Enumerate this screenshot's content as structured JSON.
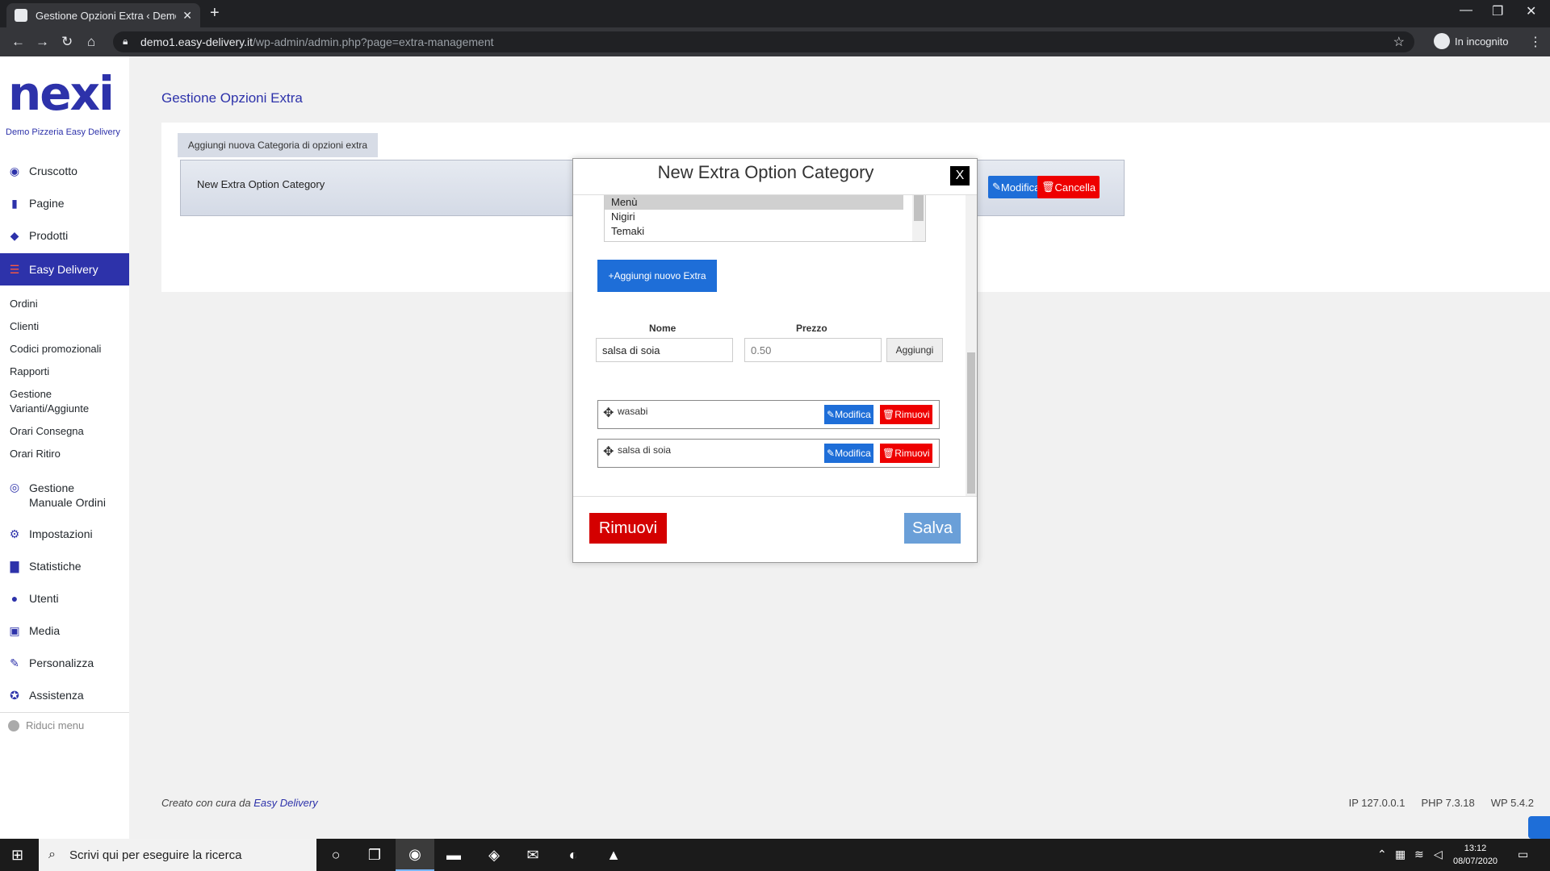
{
  "browser": {
    "tab_title": "Gestione Opzioni Extra ‹ Demo P",
    "tab_close": "✕",
    "new_tab": "+",
    "url_host": "demo1.easy-delivery.it",
    "url_path": "/wp-admin/admin.php?page=extra-management",
    "incognito_label": "In incognito",
    "window_controls": [
      "—",
      "❐",
      "✕"
    ]
  },
  "sidebar": {
    "logo": "nexi",
    "site_name": "Demo Pizzeria Easy Delivery",
    "items": [
      {
        "label": "Cruscotto",
        "icon": "dashboard-icon"
      },
      {
        "label": "Pagine",
        "icon": "pages-icon"
      },
      {
        "label": "Prodotti",
        "icon": "products-icon"
      },
      {
        "label": "Easy Delivery",
        "icon": "burger-icon"
      }
    ],
    "submenu": [
      "Ordini",
      "Clienti",
      "Codici promozionali",
      "Rapporti",
      "Gestione Varianti/Aggiunte",
      "Orari Consegna",
      "Orari Ritiro"
    ],
    "items2": [
      {
        "label": "Gestione Manuale Ordini",
        "icon": "eye-icon"
      },
      {
        "label": "Impostazioni",
        "icon": "gear-icon"
      },
      {
        "label": "Statistiche",
        "icon": "stats-icon"
      },
      {
        "label": "Utenti",
        "icon": "user-icon"
      },
      {
        "label": "Media",
        "icon": "media-icon"
      },
      {
        "label": "Personalizza",
        "icon": "brush-icon"
      },
      {
        "label": "Assistenza",
        "icon": "lifebuoy-icon"
      }
    ],
    "collapse": "Riduci menu"
  },
  "main": {
    "title": "Gestione Opzioni Extra",
    "add_category_tab": "Aggiungi nuova Categoria di opzioni extra",
    "category_name": "New Extra Option Category",
    "edit_label": "Modifica",
    "delete_label": "Cancella"
  },
  "modal": {
    "title": "New Extra Option Category",
    "close": "X",
    "list_options": [
      "Menù",
      "Nigiri",
      "Temaki"
    ],
    "selected_option": "Menù",
    "add_extra_label": "Aggiungi nuovo Extra",
    "name_col": "Nome",
    "price_col": "Prezzo",
    "name_value": "salsa di soia",
    "price_value": "0.50",
    "add_button": "Aggiungi",
    "extras": [
      {
        "name": "wasabi",
        "edit": "Modifica",
        "remove": "Rimuovi"
      },
      {
        "name": "salsa di soia",
        "edit": "Modifica",
        "remove": "Rimuovi"
      }
    ],
    "remove_button": "Rimuovi",
    "save_button": "Salva"
  },
  "footer": {
    "credit_prefix": "Creato con cura da",
    "credit_link": "Easy Delivery",
    "ip": "IP 127.0.0.1",
    "php": "PHP 7.3.18",
    "wp": "WP 5.4.2"
  },
  "taskbar": {
    "search_placeholder": "Scrivi qui per eseguire la ricerca",
    "time": "13:12",
    "date": "08/07/2020"
  },
  "colors": {
    "brand": "#2d32aa",
    "primary_button": "#1e6ed8",
    "danger_button": "#e00000"
  }
}
